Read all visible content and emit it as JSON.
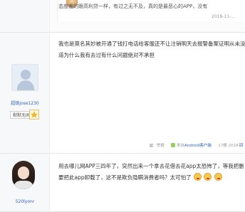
{
  "post1": {
    "quote_text": "态度差的跟高利贷一样，有过之无不及，真的是最恶心的APP，没有",
    "date": "2018-11-..."
  },
  "post2": {
    "username": "超级jose1230",
    "level": "默默无闻",
    "lines": [
      "我也是莫名其妙被开通了钱打电话给客服还不让注销明天去报警备案证明从未没",
      "道为什么我有去过有什么问题绝对不承担"
    ],
    "report_label": "举报",
    "source_prefix": "来自",
    "source_link": "Android客户端",
    "floor_and_date": "17楼  2018-",
    "reply_label": "回"
  },
  "post3": {
    "username": "520lyonr",
    "lines": [
      "用去哪儿网APP三四年了，突然出来一个拿去花借去花app太恐怖了，等我把删",
      "要把此app卸载了，这不是欺负隐瞒消费者吗？太可怕了"
    ],
    "emoji_count": 3
  }
}
